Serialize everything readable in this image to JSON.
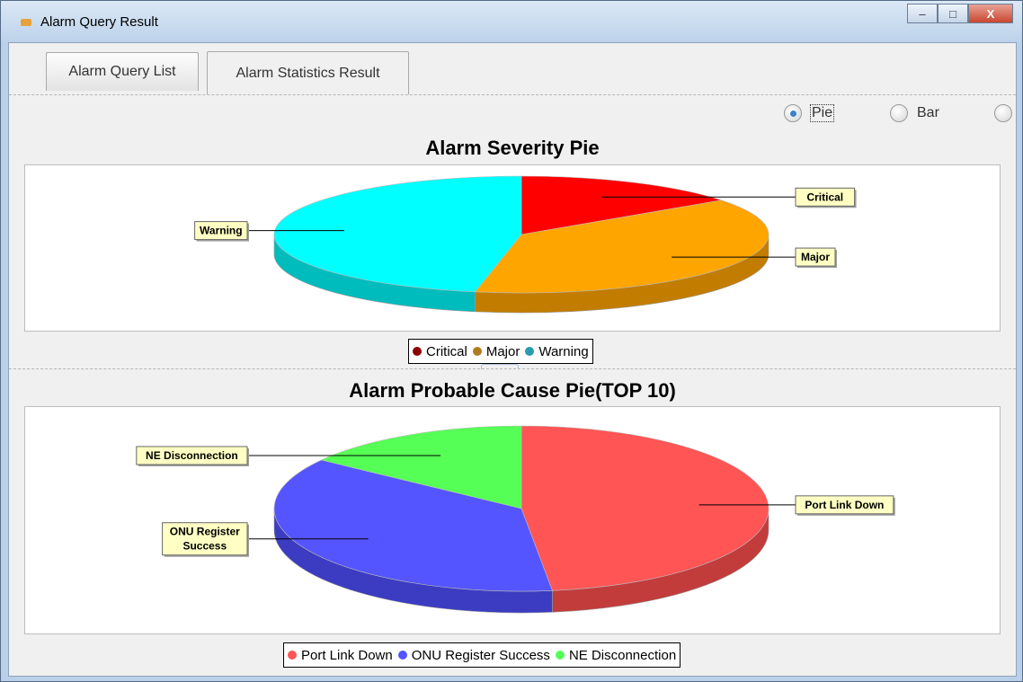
{
  "window": {
    "title": "Alarm Query Result",
    "controls": {
      "minimize": "–",
      "maximize": "□",
      "close": "X"
    }
  },
  "tabs": [
    {
      "label": "Alarm Query List",
      "active": false
    },
    {
      "label": "Alarm Statistics Result",
      "active": true
    }
  ],
  "chart_type_options": [
    {
      "label": "Pie",
      "selected": true
    },
    {
      "label": "Bar",
      "selected": false
    },
    {
      "label": "",
      "selected": false
    }
  ],
  "colors": {
    "critical": "#ff0000",
    "major": "#ffa500",
    "warning": "#00ffff",
    "port_link_down": "#ff5555",
    "onu_register_success": "#5555ff",
    "ne_disconnection": "#55ff55"
  },
  "chart_data": [
    {
      "type": "pie",
      "title": "Alarm Severity Pie",
      "categories": [
        "Critical",
        "Major",
        "Warning"
      ],
      "values": [
        15,
        38,
        47
      ],
      "colors": [
        "#ff0000",
        "#ffa500",
        "#00ffff"
      ],
      "dark_colors": [
        "#b00000",
        "#c27d00",
        "#00bcbc"
      ],
      "labels": [
        "Critical",
        "Major",
        "Warning"
      ],
      "legend": [
        "Critical",
        "Major",
        "Warning"
      ],
      "legend_position": "bottom"
    },
    {
      "type": "pie",
      "title": "Alarm Probable Cause Pie(TOP 10)",
      "categories": [
        "Port Link Down",
        "ONU Register Success",
        "NE Disconnection"
      ],
      "values": [
        48,
        37,
        15
      ],
      "colors": [
        "#ff5555",
        "#5555ff",
        "#55ff55"
      ],
      "dark_colors": [
        "#c23c3c",
        "#3c3cc2",
        "#3cc23c"
      ],
      "labels": [
        "Port Link Down",
        "ONU Register\nSuccess",
        "NE Disconnection"
      ],
      "legend": [
        "Port Link Down",
        "ONU Register Success",
        "NE Disconnection"
      ],
      "legend_position": "bottom"
    }
  ]
}
